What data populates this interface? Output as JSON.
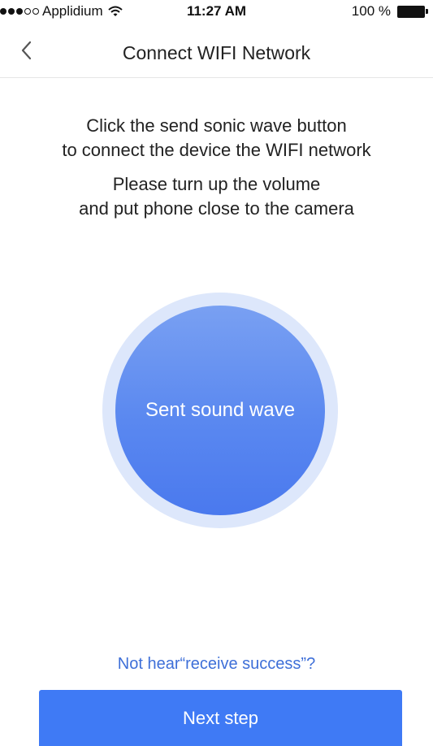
{
  "status_bar": {
    "carrier": "Applidium",
    "time": "11:27 AM",
    "battery": "100 %"
  },
  "nav": {
    "title": "Connect WIFI Network",
    "back_icon": "chevron-left-icon"
  },
  "instructions": {
    "line1": "Click the send sonic wave button",
    "line2": "to connect the device the WIFI network",
    "line3": "Please turn up the volume",
    "line4": "and put phone close to the camera"
  },
  "sonic_button": {
    "label": "Sent sound wave"
  },
  "help_link": {
    "label": "Not hear“receive success”?"
  },
  "next_button": {
    "label": "Next step"
  },
  "colors": {
    "accent": "#3f7af5",
    "link": "#3e6fd8",
    "circle_ring": "#dde7fb"
  }
}
